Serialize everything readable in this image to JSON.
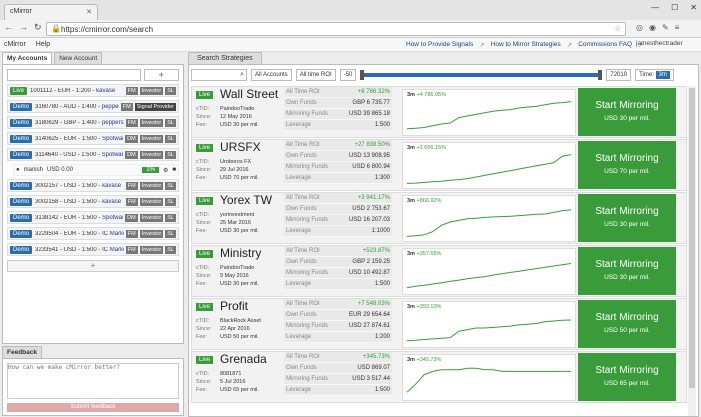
{
  "browser": {
    "tab_title": "cMirror",
    "url": "https://cmirror.com/search"
  },
  "app": {
    "menu": [
      "cMirror",
      "Help"
    ],
    "links": [
      "How to Provide Signals",
      "How to Mirror Strategies",
      "Commissions FAQ"
    ],
    "user": "jamesthectrader"
  },
  "left": {
    "tabs": [
      "My Accounts",
      "New Account"
    ],
    "accounts": [
      {
        "type": "Live",
        "text": "1001112 - EUR - 1:200 - ",
        "broker": "kavase",
        "btns": [
          "FM",
          "Investor",
          "SL"
        ]
      },
      {
        "type": "Demo",
        "text": "3160780 - AUD - 1:400 - ",
        "broker": "pepperstone",
        "btns": [
          "FM",
          "Signal Provider"
        ]
      },
      {
        "type": "Demo",
        "text": "3180629 - GBP - 1:400 - ",
        "broker": "pepperstone",
        "btns": [
          "FM",
          "Investor",
          "SL"
        ]
      },
      {
        "type": "Demo",
        "text": "3140625 - EUR - 1:500 - ",
        "broker": "Spotware",
        "btns": [
          "DM",
          "Investor",
          "SL"
        ]
      },
      {
        "type": "Demo",
        "text": "3114640 - USD - 1:500 - ",
        "broker": "Spotware",
        "btns": [
          "DM",
          "Investor",
          "SL"
        ]
      },
      {
        "type": "Demo",
        "text": "3002157 - USD - 1:500 - ",
        "broker": "kavase",
        "btns": [
          "FM",
          "Investor",
          "SL"
        ]
      },
      {
        "type": "Demo",
        "text": "3002158 - USD - 1:500 - ",
        "broker": "kavase",
        "btns": [
          "FM",
          "Investor",
          "SL"
        ]
      },
      {
        "type": "Demo",
        "text": "3138142 - EUR - 1:500 - ",
        "broker": "Spotware",
        "btns": [
          "DM",
          "Investor",
          "SL"
        ]
      },
      {
        "type": "Demo",
        "text": "3229504 - EUR - 1:500 - ",
        "broker": "IC Markets",
        "btns": [
          "FM",
          "Investor",
          "SL"
        ]
      },
      {
        "type": "Demo",
        "text": "3233541 - USD - 1:500 - ",
        "broker": "IC Markets",
        "btns": [
          "FM",
          "Investor",
          "SL"
        ]
      }
    ],
    "sub": {
      "name": "manish",
      "value": "USD 0.00",
      "pct": "1%"
    }
  },
  "feedback": {
    "tab": "Feedback",
    "placeholder": "How can we make cMirror better?",
    "submit": "Submit feedback"
  },
  "right": {
    "tab": "Search Strategies",
    "filter_all": "All Accounts",
    "roi_label": "All time ROI",
    "roi_min": "-50",
    "roi_max": "72010",
    "time_label": "Time:",
    "time_value": "3m",
    "stat_labels": {
      "roi": "All Time ROI",
      "own": "Own Funds",
      "mirror": "Mirroring Funds",
      "lev": "Leverage"
    },
    "info_labels": {
      "ctid": "cTID:",
      "since": "Since:",
      "fee": "Fee:"
    },
    "mirror_label": "Start Mirroring",
    "strategies": [
      {
        "name": "Wall Street",
        "ctid": "PaindooTrade",
        "since": "12 May 2016",
        "fee": "USD 30 per mil.",
        "roi": "+8 786.32%",
        "own": "GBP 6 735.77",
        "mirroring": "USD 39 865.18",
        "lev": "1:500",
        "chart_lbl": "3m",
        "chart_roi": "+4 786.05%",
        "price": "USD 30 per mil.",
        "curve": [
          0.9,
          0.88,
          0.86,
          0.8,
          0.75,
          0.72,
          0.55,
          0.5,
          0.45,
          0.4,
          0.35,
          0.32,
          0.3,
          0.25,
          0.22,
          0.2,
          0.15,
          0.1,
          0.08,
          0.05
        ]
      },
      {
        "name": "URSFX",
        "ctid": "Uroboros FX",
        "since": "29 Jul 2016",
        "fee": "USD 70 per mil.",
        "roi": "+27 838.50%",
        "own": "USD 13 908.95",
        "mirroring": "USD 6 800.94",
        "lev": "1:300",
        "chart_lbl": "3m",
        "chart_roi": "+1 656.15%",
        "price": "USD 70 per mil.",
        "curve": [
          0.95,
          0.94,
          0.92,
          0.9,
          0.88,
          0.85,
          0.83,
          0.8,
          0.75,
          0.7,
          0.65,
          0.6,
          0.55,
          0.5,
          0.45,
          0.4,
          0.35,
          0.3,
          0.1,
          0.05
        ]
      },
      {
        "name": "Yorex TW",
        "ctid": "yorinvestment",
        "since": "25 Mar 2016",
        "fee": "USD 30 per mil.",
        "roi": "+3 941.17%",
        "own": "USD 2 753.67",
        "mirroring": "USD 16 207.03",
        "lev": "1:1000",
        "chart_lbl": "3m",
        "chart_roi": "+866.92%",
        "price": "USD 30 per mil.",
        "curve": [
          0.95,
          0.93,
          0.9,
          0.8,
          0.6,
          0.5,
          0.45,
          0.4,
          0.38,
          0.36,
          0.34,
          0.33,
          0.32,
          0.3,
          0.28,
          0.26,
          0.25,
          0.2,
          0.15,
          0.12
        ]
      },
      {
        "name": "Ministry",
        "ctid": "PaindooTrade",
        "since": "9 May 2016",
        "fee": "USD 30 per mil.",
        "roi": "+523.87%",
        "own": "GBP 2 159.25",
        "mirroring": "USD 10 492.87",
        "lev": "1:500",
        "chart_lbl": "3m",
        "chart_roi": "+357.65%",
        "price": "USD 30 per mil.",
        "curve": [
          0.9,
          0.85,
          0.82,
          0.78,
          0.74,
          0.7,
          0.66,
          0.62,
          0.58,
          0.55,
          0.5,
          0.46,
          0.42,
          0.38,
          0.34,
          0.3,
          0.26,
          0.22,
          0.18,
          0.14
        ]
      },
      {
        "name": "Profit",
        "ctid": "BlackRock Asset",
        "since": "22 Apr 2016",
        "fee": "USD 50 per mil.",
        "roi": "+7 548.03%",
        "own": "EUR 29 654.64",
        "mirroring": "USD 27 874.61",
        "lev": "1:200",
        "chart_lbl": "3m",
        "chart_roi": "+393.10%",
        "price": "USD 50 per mil.",
        "curve": [
          0.9,
          0.88,
          0.86,
          0.84,
          0.82,
          0.8,
          0.6,
          0.55,
          0.5,
          0.5,
          0.48,
          0.46,
          0.44,
          0.4,
          0.38,
          0.36,
          0.3,
          0.28,
          0.26,
          0.25
        ]
      },
      {
        "name": "Grenada",
        "ctid": "8081871",
        "since": "5 Jul 2016",
        "fee": "USD 65 per mil.",
        "roi": "+345.73%",
        "own": "USD 869.07",
        "mirroring": "USD 3 517.44",
        "lev": "1:500",
        "chart_lbl": "3m",
        "chart_roi": "+345.73%",
        "price": "USD 65 per mil.",
        "curve": [
          0.85,
          0.6,
          0.3,
          0.2,
          0.15,
          0.15,
          0.15,
          0.1,
          0.1,
          0.15,
          0.15,
          0.2,
          0.2,
          0.2,
          0.2,
          0.2,
          0.2,
          0.2,
          0.2,
          0.2
        ]
      }
    ]
  }
}
